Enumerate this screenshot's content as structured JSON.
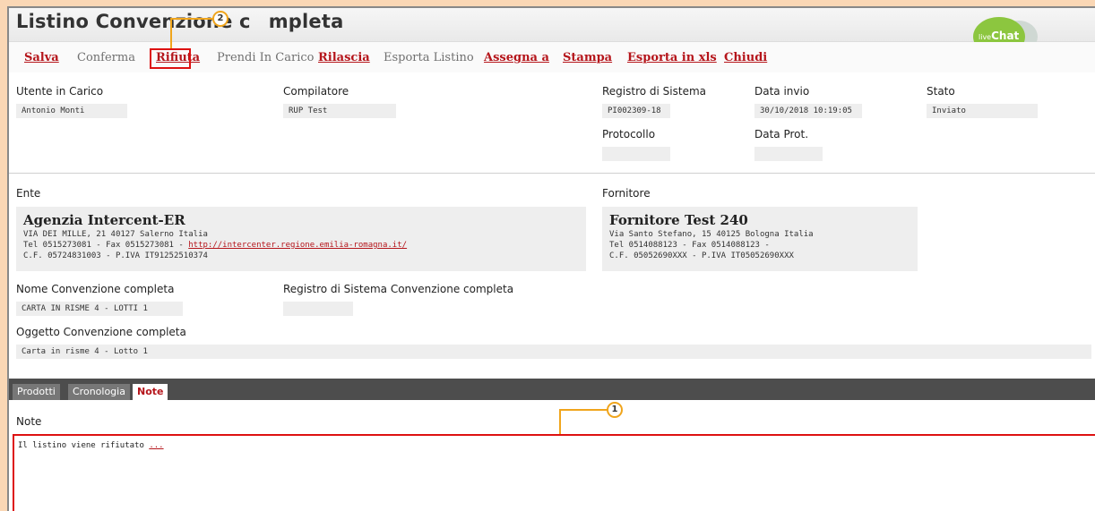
{
  "header": {
    "title_left": "Listino Convenzione c",
    "title_right": "mpleta",
    "livechat_small": "live",
    "livechat_big": "Chat"
  },
  "toolbar": {
    "salva": "Salva",
    "conferma": "Conferma",
    "rifiuta": "Rifiuta",
    "prendi": "Prendi In Carico",
    "rilascia": "Rilascia",
    "esporta_listino": "Esporta Listino",
    "assegna": "Assegna a",
    "stampa": "Stampa",
    "esporta_xls": "Esporta in xls",
    "chiudi": "Chiudi"
  },
  "callouts": {
    "one": "1",
    "two": "2"
  },
  "fields": {
    "utente_label": "Utente in Carico",
    "utente_value": "Antonio Monti",
    "compilatore_label": "Compilatore",
    "compilatore_value": "RUP Test",
    "registro_label": "Registro di Sistema",
    "registro_value": "PI002309-18",
    "data_invio_label": "Data invio",
    "data_invio_value": "30/10/2018 10:19:05",
    "stato_label": "Stato",
    "stato_value": "Inviato",
    "protocollo_label": "Protocollo",
    "protocollo_value": "",
    "data_prot_label": "Data Prot.",
    "data_prot_value": ""
  },
  "ente": {
    "label": "Ente",
    "name": "Agenzia Intercent-ER",
    "address": "VIA DEI MILLE, 21 40127 Salerno Italia",
    "phone": "Tel 0515273081 - Fax 0515273081 - ",
    "url": "http://intercenter.regione.emilia-romagna.it/",
    "fiscal": "C.F. 05724831003 - P.IVA IT91252510374"
  },
  "fornitore": {
    "label": "Fornitore",
    "name": "Fornitore Test 240",
    "address": "Via Santo Stefano, 15 40125 Bologna Italia",
    "phone": "Tel 0514088123 - Fax 0514088123 -",
    "fiscal": "C.F. 05052690XXX - P.IVA IT05052690XXX"
  },
  "convenzione": {
    "nome_label": "Nome Convenzione completa",
    "nome_value": "CARTA IN RISME 4 - LOTTI 1",
    "registro_label": "Registro di Sistema Convenzione completa",
    "registro_value": "",
    "oggetto_label": "Oggetto Convenzione completa",
    "oggetto_value": "Carta in risme 4 - Lotto 1"
  },
  "tabs": [
    {
      "label": "Prodotti"
    },
    {
      "label": "Cronologia"
    },
    {
      "label": "Note"
    }
  ],
  "note": {
    "label": "Note",
    "text": "Il listino viene rifiutato ",
    "suffix": "..."
  },
  "colors": {
    "accent_red": "#b5151b",
    "callout_orange": "#f0a51c",
    "highlight_red": "#dd1111",
    "background_peach": "#fad7b5",
    "livechat_green": "#8cc63f"
  }
}
